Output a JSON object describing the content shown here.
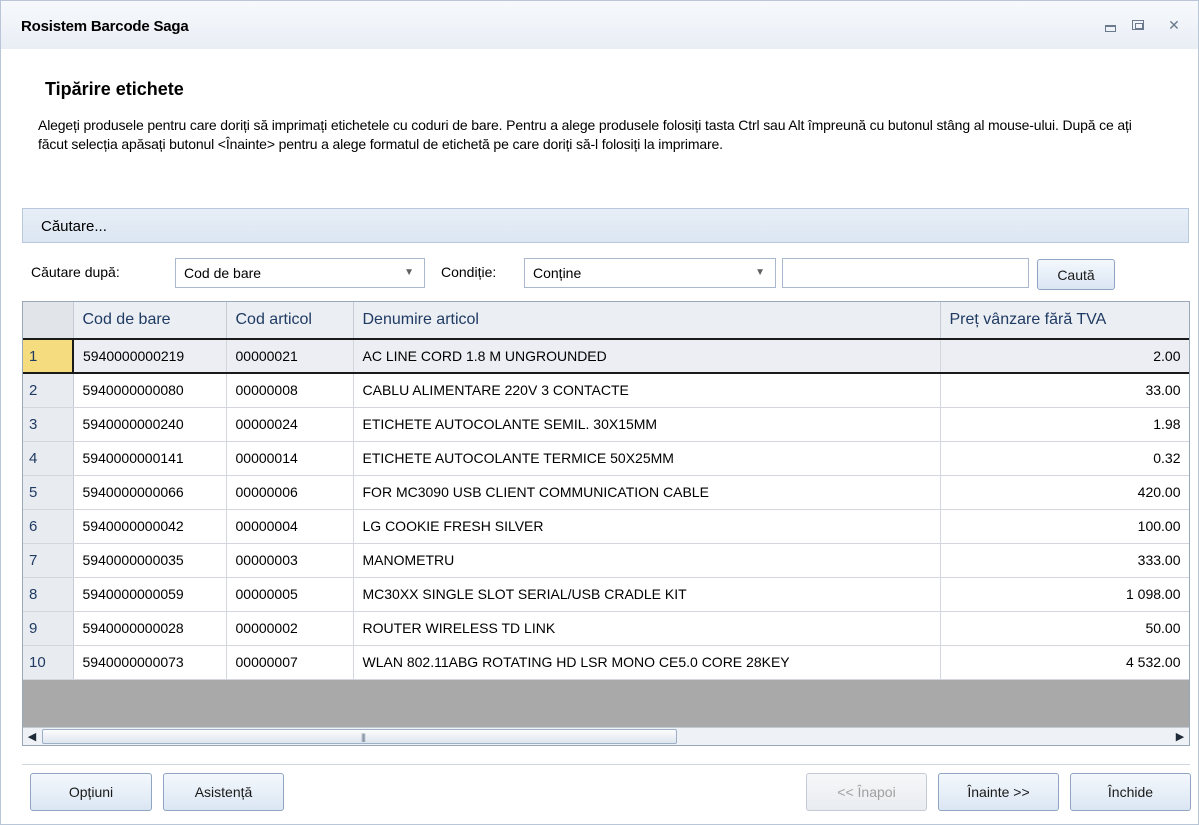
{
  "window": {
    "title": "Rosistem Barcode Saga"
  },
  "page": {
    "heading": "Tipărire etichete",
    "description": "Alegeți produsele pentru care doriți să imprimați etichetele cu coduri de bare. Pentru a alege produsele folosiți tasta Ctrl sau Alt împreună cu butonul stâng al mouse-ului. După ce ați făcut selecția apăsați butonul <Înainte> pentru a alege formatul de etichetă pe care doriți să-l folosiți la imprimare."
  },
  "search": {
    "bar_label": "Căutare...",
    "by_label": "Căutare după:",
    "by_value": "Cod de bare",
    "condition_label": "Condiție:",
    "condition_value": "Conține",
    "text_value": "",
    "search_button": "Caută"
  },
  "table": {
    "columns": [
      "Cod de bare",
      "Cod articol",
      "Denumire articol",
      "Preț vânzare fără TVA"
    ],
    "rows": [
      {
        "n": "1",
        "barcode": "5940000000219",
        "code": "00000021",
        "name": "AC LINE CORD 1.8 M UNGROUNDED",
        "price": "2.00"
      },
      {
        "n": "2",
        "barcode": "5940000000080",
        "code": "00000008",
        "name": "CABLU ALIMENTARE 220V 3 CONTACTE",
        "price": "33.00"
      },
      {
        "n": "3",
        "barcode": "5940000000240",
        "code": "00000024",
        "name": "ETICHETE AUTOCOLANTE SEMIL. 30X15MM",
        "price": "1.98"
      },
      {
        "n": "4",
        "barcode": "5940000000141",
        "code": "00000014",
        "name": "ETICHETE AUTOCOLANTE TERMICE 50X25MM",
        "price": "0.32"
      },
      {
        "n": "5",
        "barcode": "5940000000066",
        "code": "00000006",
        "name": "FOR MC3090 USB CLIENT COMMUNICATION CABLE",
        "price": "420.00"
      },
      {
        "n": "6",
        "barcode": "5940000000042",
        "code": "00000004",
        "name": "LG COOKIE FRESH SILVER",
        "price": "100.00"
      },
      {
        "n": "7",
        "barcode": "5940000000035",
        "code": "00000003",
        "name": "MANOMETRU",
        "price": "333.00"
      },
      {
        "n": "8",
        "barcode": "5940000000059",
        "code": "00000005",
        "name": "MC30XX SINGLE SLOT SERIAL/USB CRADLE KIT",
        "price": "1 098.00"
      },
      {
        "n": "9",
        "barcode": "5940000000028",
        "code": "00000002",
        "name": "ROUTER WIRELESS TD LINK",
        "price": "50.00"
      },
      {
        "n": "10",
        "barcode": "5940000000073",
        "code": "00000007",
        "name": "WLAN 802.11ABG ROTATING HD LSR MONO CE5.0 CORE 28KEY",
        "price": "4 532.00"
      }
    ],
    "selected_row": "1"
  },
  "footer": {
    "options_button": "Opțiuni",
    "help_button": "Asistență",
    "back_button": "<< Înapoi",
    "next_button": "Înainte >>",
    "close_button": "Închide"
  },
  "icons": {
    "minimize": "minimize-icon",
    "maximize": "maximize-icon",
    "close": "close-icon",
    "dropdown": "chevron-down-icon",
    "scroll_left": "arrow-left-icon",
    "scroll_right": "arrow-right-icon"
  },
  "colors": {
    "selected_row_header": "#f5dc7e",
    "grid_background": "#a9a9a9",
    "header_text": "#1f3b63"
  }
}
